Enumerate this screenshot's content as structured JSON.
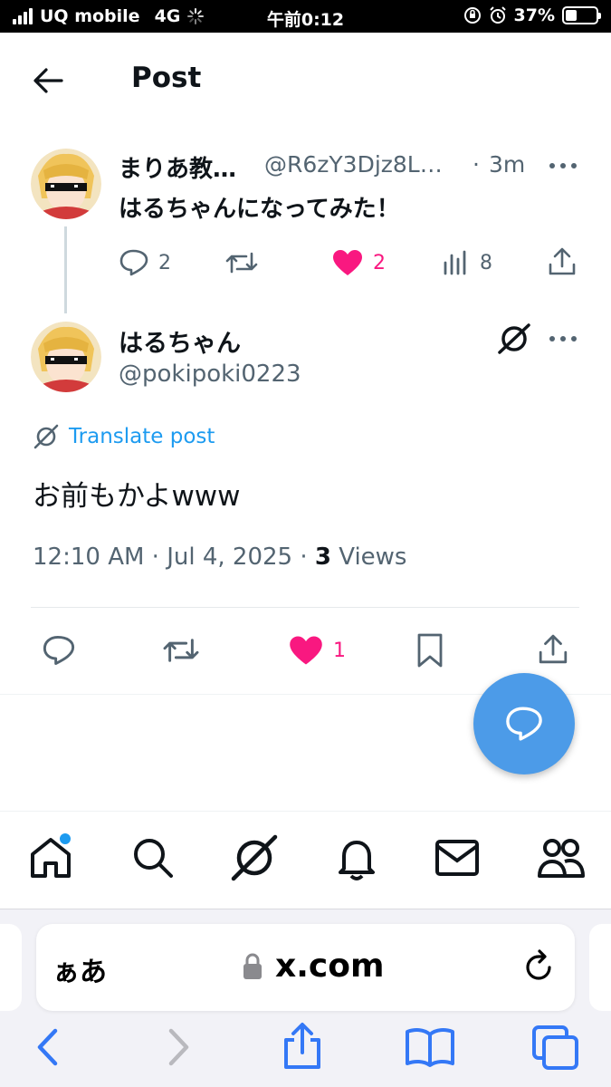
{
  "status_bar": {
    "carrier": "UQ mobile",
    "network": "4G",
    "time": "午前0:12",
    "battery": "37%",
    "battery_level": 0.37
  },
  "header": {
    "title": "Post"
  },
  "parent_post": {
    "name": "まりあ教…",
    "handle": "@R6zY3Djz8L…",
    "separator": "·",
    "time": "3m",
    "text": "はるちゃんになってみた！",
    "replies": "2",
    "likes": "2",
    "views": "8"
  },
  "main_post": {
    "name": "はるちゃん",
    "handle": "@pokipoki0223",
    "translate_label": "Translate post",
    "text": "お前もかよwww",
    "datetime": "12:10 AM · Jul 4, 2025 · ",
    "views_count": "3",
    "views_label": " Views",
    "likes": "1"
  },
  "colors": {
    "accent": "#1d9bf0",
    "like": "#f91880",
    "fab": "#4c9be8",
    "muted": "#536471"
  },
  "safari": {
    "text_size_label": "ぁあ",
    "url": "x.com"
  }
}
